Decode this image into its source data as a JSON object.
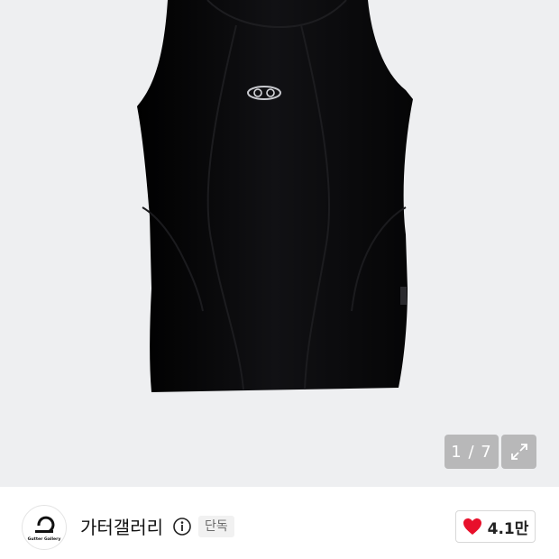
{
  "gallery": {
    "current": "1",
    "separator": " / ",
    "total": "7",
    "counter_text": "1 / 7"
  },
  "brand": {
    "logo_text": "Gutter Gallery",
    "name": "가터갤러리",
    "badge": "단독"
  },
  "likes": {
    "count": "4.1만"
  },
  "colors": {
    "like_heart": "#e8102b",
    "hero_bg": "#eeeff1",
    "garment": "#0b0b0d"
  },
  "icons": {
    "expand": "expand-icon",
    "info": "info-icon",
    "heart": "heart-icon"
  }
}
